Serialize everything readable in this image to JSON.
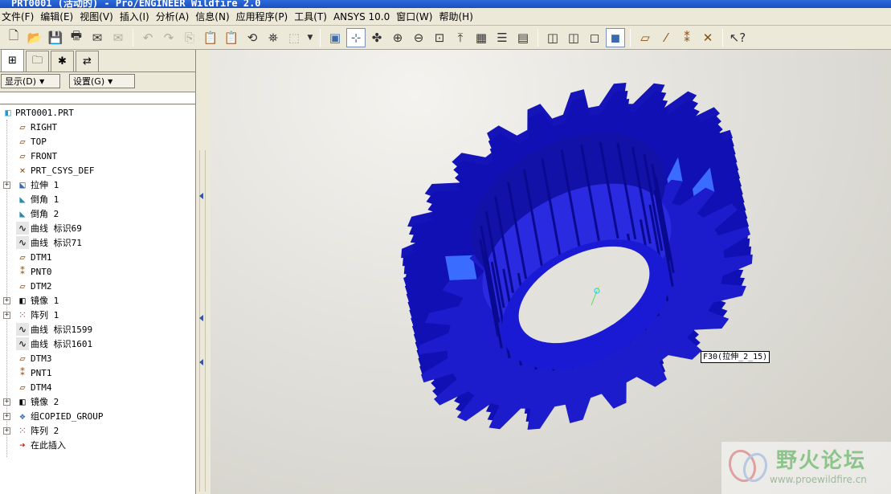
{
  "window": {
    "title": "PRT0001 (活动的) - Pro/ENGINEER Wildfire 2.0"
  },
  "menu": [
    "文件(F)",
    "编辑(E)",
    "视图(V)",
    "插入(I)",
    "分析(A)",
    "信息(N)",
    "应用程序(P)",
    "工具(T)",
    "ANSYS 10.0",
    "窗口(W)",
    "帮助(H)"
  ],
  "toolbar": {
    "new_icon": "new-file-icon",
    "pressed_buttons": [
      "spin-center-icon",
      "shaded-display-icon"
    ]
  },
  "panel": {
    "display_button": "显示(D)",
    "settings_button": "设置(G)"
  },
  "model_tree": [
    {
      "label": "PRT0001.PRT",
      "icon": "part-icon",
      "expandable": false
    },
    {
      "label": "RIGHT",
      "icon": "datum-plane-icon",
      "expandable": false
    },
    {
      "label": "TOP",
      "icon": "datum-plane-icon",
      "expandable": false
    },
    {
      "label": "FRONT",
      "icon": "datum-plane-icon",
      "expandable": false
    },
    {
      "label": "PRT_CSYS_DEF",
      "icon": "coordinate-system-icon",
      "expandable": false
    },
    {
      "label": "拉伸 1",
      "icon": "extrude-icon",
      "expandable": true
    },
    {
      "label": "倒角 1",
      "icon": "chamfer-icon",
      "expandable": false
    },
    {
      "label": "倒角 2",
      "icon": "chamfer-icon",
      "expandable": false
    },
    {
      "label": "曲线 标识69",
      "icon": "curve-icon",
      "expandable": false
    },
    {
      "label": "曲线 标识71",
      "icon": "curve-icon",
      "expandable": false
    },
    {
      "label": "DTM1",
      "icon": "datum-plane-icon",
      "expandable": false
    },
    {
      "label": "PNT0",
      "icon": "datum-point-icon",
      "expandable": false
    },
    {
      "label": "DTM2",
      "icon": "datum-plane-icon",
      "expandable": false
    },
    {
      "label": "镜像 1",
      "icon": "mirror-icon",
      "expandable": true
    },
    {
      "label": "阵列 1",
      "icon": "pattern-icon",
      "expandable": true
    },
    {
      "label": "曲线 标识1599",
      "icon": "curve-icon",
      "expandable": false
    },
    {
      "label": "曲线 标识1601",
      "icon": "curve-icon",
      "expandable": false
    },
    {
      "label": "DTM3",
      "icon": "datum-plane-icon",
      "expandable": false
    },
    {
      "label": "PNT1",
      "icon": "datum-point-icon",
      "expandable": false
    },
    {
      "label": "DTM4",
      "icon": "datum-plane-icon",
      "expandable": false
    },
    {
      "label": "镜像 2",
      "icon": "mirror-icon",
      "expandable": true
    },
    {
      "label": "组COPIED_GROUP",
      "icon": "group-icon",
      "expandable": true
    },
    {
      "label": "阵列 2",
      "icon": "pattern-icon",
      "expandable": true
    },
    {
      "label": "在此插入",
      "icon": "insert-here-arrow-icon",
      "expandable": false
    }
  ],
  "viewport": {
    "tooltip": "F30(拉伸_2_15)",
    "model_color": "#1c1ccc",
    "background_color": "#e2e1dc"
  },
  "watermark": {
    "title": "野火论坛",
    "url": "www.proewildfire.cn"
  }
}
